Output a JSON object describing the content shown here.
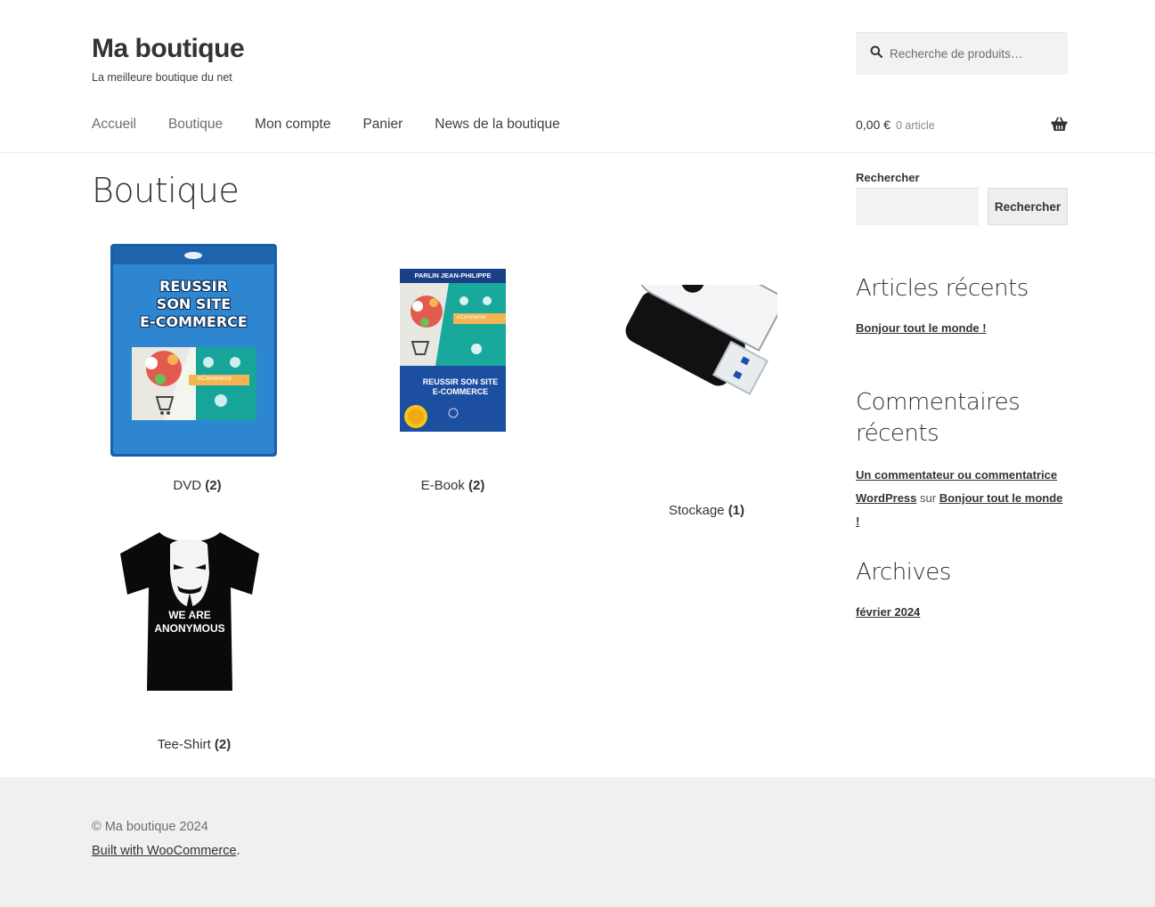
{
  "site": {
    "title": "Ma boutique",
    "tagline": "La meilleure boutique du net"
  },
  "header_search": {
    "placeholder": "Recherche de produits…",
    "icon": "search-icon"
  },
  "nav": {
    "items": [
      {
        "label": "Accueil"
      },
      {
        "label": "Boutique"
      },
      {
        "label": "Mon compte"
      },
      {
        "label": "Panier"
      },
      {
        "label": "News de la boutique"
      }
    ]
  },
  "cart": {
    "amount": "0,00 €",
    "count": "0 article",
    "icon": "basket-icon"
  },
  "page": {
    "title": "Boutique"
  },
  "categories": [
    {
      "name": "DVD",
      "count": "(2)",
      "image": "dvd-cover-image",
      "image_text": [
        "REUSSIR",
        "SON SITE",
        "E-COMMERCE"
      ],
      "image_badge": "eCommerce"
    },
    {
      "name": "E-Book",
      "count": "(2)",
      "image": "ebook-cover-image",
      "image_text": [
        "PARLIN JEAN-PHILIPPE",
        "REUSSIR SON SITE",
        "E-COMMERCE"
      ],
      "image_badge": "eCommerce"
    },
    {
      "name": "Stockage",
      "count": "(1)",
      "image": "usb-drive-image"
    },
    {
      "name": "Tee-Shirt",
      "count": "(2)",
      "image": "tshirt-image",
      "image_text": [
        "WE ARE",
        "ANONYMOUS"
      ]
    }
  ],
  "sidebar": {
    "search": {
      "label": "Rechercher",
      "button": "Rechercher"
    },
    "recent_posts": {
      "title": "Articles récents",
      "items": [
        "Bonjour tout le monde !"
      ]
    },
    "recent_comments": {
      "title_line1": "Commentaires",
      "title_line2": "récents",
      "author": "Un commentateur ou commentatrice WordPress",
      "connector": "sur",
      "post": "Bonjour tout le monde !"
    },
    "archives": {
      "title": "Archives",
      "items": [
        "février 2024"
      ]
    }
  },
  "footer": {
    "copyright": "© Ma boutique 2024",
    "built_with": "Built with WooCommerce",
    "built_suffix": "."
  },
  "colors": {
    "text": "#333333",
    "muted": "#6d6d6d",
    "footer_bg": "#f0f0f0",
    "input_bg": "#f2f2f2"
  }
}
